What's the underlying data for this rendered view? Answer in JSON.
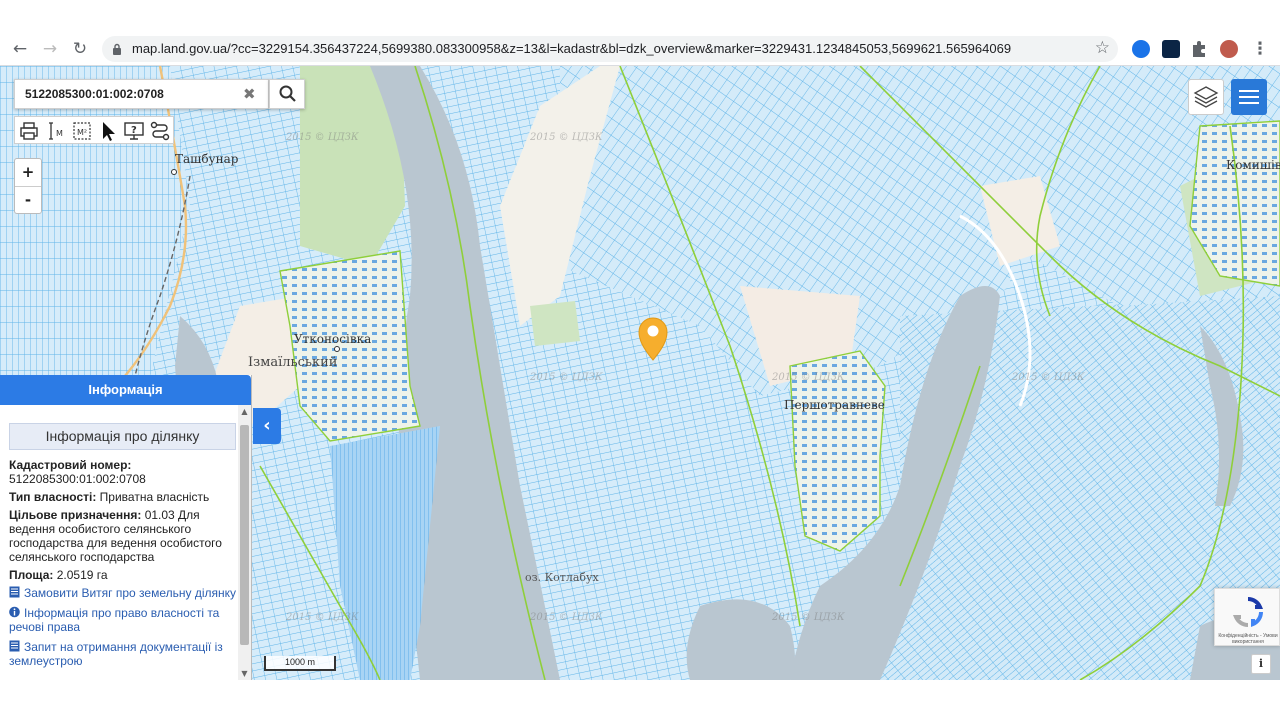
{
  "browser": {
    "url": "map.land.gov.ua/?cc=3229154.356437224,5699380.083300958&z=13&l=kadastr&bl=dzk_overview&marker=3229431.1234845053,5699621.565964069",
    "icons": [
      "back-icon",
      "forward-icon",
      "reload-icon",
      "lock-icon",
      "star-icon",
      "extension-icon",
      "menu-icon"
    ]
  },
  "search": {
    "value": "5122085300:01:002:0708"
  },
  "map": {
    "places": {
      "tashbunar": "Ташбунар",
      "utkonosivka": "Утконосівка",
      "izmailskyi": "Ізмаїльський",
      "pershotravneve": "Першотравневе",
      "kotlabukh": "оз. Котлабух",
      "komyshivka": "Комишівка"
    },
    "watermark": "2015 © ЦДЗК",
    "scale_label": "1000 m",
    "colors": {
      "water": "#b9c6d0",
      "parcel_fill": "#cfe8f8",
      "parcel_stroke": "#5fb4e8",
      "boundary": "#8fcf3a",
      "marker": "#f6ae2d"
    }
  },
  "info_panel": {
    "header": "Інформація",
    "title": "Інформація про ділянку",
    "cadastral_label": "Кадастровий номер:",
    "cadastral_value": "5122085300:01:002:0708",
    "ownership_label": "Тип власності:",
    "ownership_value": "Приватна власність",
    "purpose_label": "Цільове призначення:",
    "purpose_value": "01.03 Для ведення особистого селянського господарства для ведення особистого селянського господарства",
    "area_label": "Площа:",
    "area_value": "2.0519 га",
    "links": [
      "Замовити Витяг про земельну ділянку",
      "Інформація про право власності та речові права",
      "Запит на отримання документації із землеустрою"
    ]
  },
  "recaptcha": {
    "text": "Конфіденційність - Умови використання"
  },
  "info_button": "i"
}
